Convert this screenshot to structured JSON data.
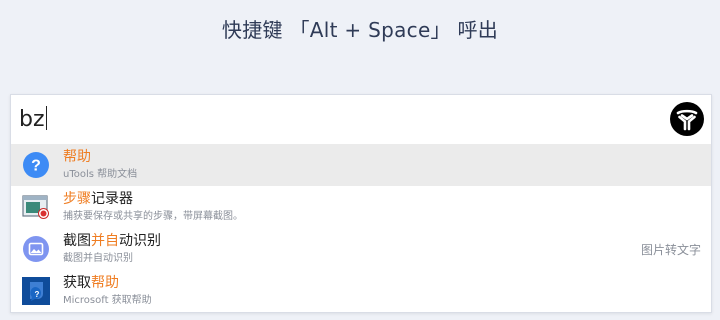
{
  "hint": "快捷键 「Alt + Space」 呼出",
  "search": {
    "query": "bz"
  },
  "colors": {
    "highlight": "#ef7d22",
    "selected_row": "#ebebeb",
    "help_icon": "#3d8bf5"
  },
  "results": [
    {
      "icon": "help-circle-icon",
      "title": [
        {
          "text": "帮助",
          "hl": true
        }
      ],
      "desc": "uTools 帮助文档",
      "tag": "",
      "selected": true
    },
    {
      "icon": "steps-recorder-icon",
      "title": [
        {
          "text": "步骤",
          "hl": true
        },
        {
          "text": "记录器",
          "hl": false
        }
      ],
      "desc": "捕获要保存或共享的步骤，带屏幕截图。",
      "tag": "",
      "selected": false
    },
    {
      "icon": "image-ocr-icon",
      "title": [
        {
          "text": "截图",
          "hl": false
        },
        {
          "text": "并自",
          "hl": true
        },
        {
          "text": "动识别",
          "hl": false
        }
      ],
      "desc": "截图并自动识别",
      "tag": "图片转文字",
      "selected": false
    },
    {
      "icon": "get-help-icon",
      "title": [
        {
          "text": "获取",
          "hl": false
        },
        {
          "text": "帮助",
          "hl": true
        }
      ],
      "desc": "Microsoft 获取帮助",
      "tag": "",
      "selected": false
    }
  ]
}
